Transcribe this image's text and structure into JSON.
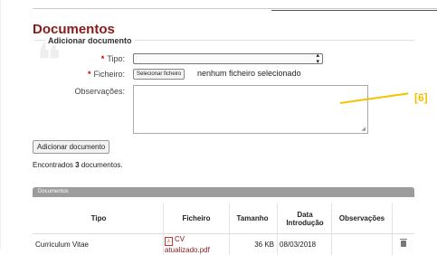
{
  "page": {
    "title": "Documentos"
  },
  "form": {
    "legend": "Adicionar documento",
    "tipo_label": "Tipo:",
    "ficheiro_label": "Ficheiro:",
    "file_button": "Selecionar ficheiro",
    "file_status": "nenhum ficheiro selecionado",
    "obs_label": "Observações:",
    "required_mark": "*"
  },
  "annotation": {
    "label": "[6]",
    "color": "#f2c200"
  },
  "actions": {
    "add_button": "Adicionar documento"
  },
  "summary": {
    "prefix": "Encontrados ",
    "count": "3",
    "suffix": " documentos."
  },
  "table": {
    "caption": "Documentos",
    "headers": [
      "Tipo",
      "Ficheiro",
      "Tamanho",
      "Data Introdução",
      "Observações",
      ""
    ],
    "rows": [
      {
        "tipo": "Curriculum Vitae",
        "ficheiro": "CV atualizado.pdf",
        "tamanho": "36 KB",
        "data": "08/03/2018",
        "observacoes": ""
      }
    ]
  },
  "colors": {
    "title": "#8b1a1a",
    "required": "#cc0000",
    "table_bar": "#9c9c9c"
  }
}
